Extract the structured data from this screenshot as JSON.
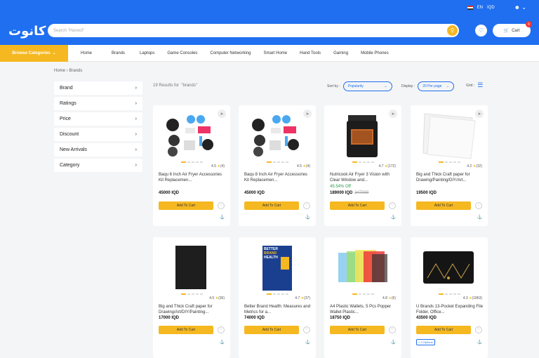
{
  "header": {
    "lang": "EN",
    "currency": "IQD",
    "logo": "كانوت",
    "search_placeholder": "Search \"Hanoot\"",
    "cart_label": "Cart",
    "cart_count": "0"
  },
  "nav": {
    "browse": "Browse Categories",
    "items": [
      "Home",
      "Brands",
      "Laptops",
      "Game Consoles",
      "Computer Networking",
      "Smart Home",
      "Hand Tools",
      "Gaming",
      "Mobile Phones"
    ]
  },
  "breadcrumb": {
    "home": "Home",
    "current": "Brands"
  },
  "filters": [
    "Brand",
    "Ratings",
    "Price",
    "Discount",
    "New Arrivals",
    "Category"
  ],
  "results": {
    "text": "19 Results for",
    "query": "\"brands\"",
    "sort_label": "Sort by :",
    "sort_value": "Popularity",
    "display_label": "Display :",
    "display_value": "20 Per page",
    "grid_label": "Grid :"
  },
  "products": [
    {
      "rating": "4.5",
      "count": "(4)",
      "name": "Baqu 6 Inch Air Fryer Accessories Kit Replacemen...",
      "price": "45000 IQD",
      "add": "Add To Cart"
    },
    {
      "rating": "4.5",
      "count": "(4)",
      "name": "Baqu 8 Inch Air Fryer Accessories Kit Replacemen...",
      "price": "45000 IQD",
      "add": "Add To Cart"
    },
    {
      "rating": "4.7",
      "count": "(172)",
      "name": "Nutricook Air Fryer 3 Vision with Clear Window and...",
      "discount": "45.54% Off",
      "price": "189000 IQD",
      "old": "347000",
      "add": "Add To Cart"
    },
    {
      "rating": "4.2",
      "count": "(32)",
      "name": "Big and Thick Craft paper for Drawing/Painting/DIY/Art...",
      "price": "19500 IQD",
      "add": "Add To Cart"
    },
    {
      "rating": "4.5",
      "count": "(36)",
      "name": "Big and Thick Craft paper for Drawing/Art/DIY/Painting...",
      "price": "17000 IQD",
      "add": "Add To Cart"
    },
    {
      "rating": "4.7",
      "count": "(37)",
      "name": "Better Brand Health: Measures and Metrics for a...",
      "price": "74000 IQD",
      "add": "Add To Cart"
    },
    {
      "rating": "4.8",
      "count": "(6)",
      "name": "A4 Plastic Wallets, 5 Pcs Popper Wallet Plastic...",
      "price": "18750 IQD",
      "add": "Add To Cart"
    },
    {
      "rating": "4.3",
      "count": "(1863)",
      "name": "U Brands 13-Pocket Expanding File Folder, Office...",
      "price": "43500 IQD",
      "add": "Add To Cart",
      "options": "+ 2 Options"
    }
  ],
  "book_cover": [
    "BETTER",
    "BRAND",
    "HEALTH"
  ],
  "colors": {
    "primary": "#1f6ff0",
    "accent": "#f5b820"
  }
}
